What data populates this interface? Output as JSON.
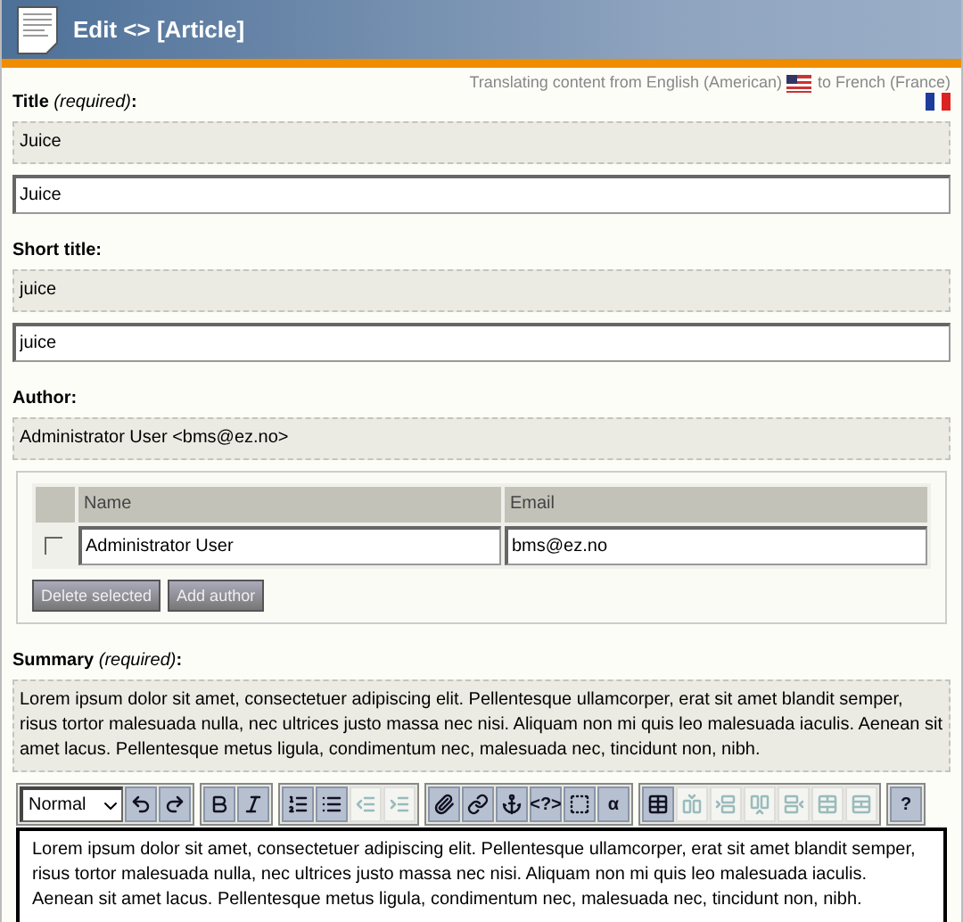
{
  "header": {
    "title": "Edit <> [Article]"
  },
  "translation": {
    "from": "Translating content from English (American)",
    "to": "to French (France)"
  },
  "fields": [
    {
      "label": "Title *(required)*:",
      "kind": "text",
      "original": "Juice",
      "value": "Juice"
    },
    {
      "label": "Short title:",
      "kind": "text",
      "original": "juice",
      "value": "juice"
    },
    {
      "label": "Author:",
      "kind": "authors",
      "original": "Administrator User <bms@ez.no>",
      "columns": [
        "Name",
        "Email"
      ],
      "rows": [
        {
          "name": "Administrator User",
          "email": "bms@ez.no",
          "checked": false
        }
      ],
      "buttons": [
        "Delete selected",
        "Add author"
      ]
    },
    {
      "label": "Summary *(required)*:",
      "kind": "richtext",
      "original": "Lorem ipsum dolor sit amet, consectetuer adipiscing elit. Pellentesque ullamcorper, erat sit amet blandit semper, risus tortor malesuada nulla, nec ultrices justo massa nec nisi. Aliquam non mi quis leo malesuada iaculis. Aenean sit amet lacus. Pellentesque metus ligula, condimentum nec, malesuada nec, tincidunt non, nibh.",
      "value": "Lorem ipsum dolor sit amet, consectetuer adipiscing elit. Pellentesque ullamcorper, erat sit amet blandit semper, risus tortor malesuada nulla, nec ultrices justo massa nec nisi. Aliquam non mi quis leo malesuada iaculis. Aenean sit amet lacus. Pellentesque metus ligula, condimentum nec, malesuada nec, tincidunt non, nibh.",
      "toolbar": [
        [
          {
            "kind": "select",
            "value": "Normal",
            "disabled": false
          },
          {
            "kind": "undo",
            "disabled": false
          },
          {
            "kind": "redo",
            "disabled": false
          }
        ],
        [
          {
            "kind": "bold",
            "disabled": false
          },
          {
            "kind": "italic",
            "disabled": false
          }
        ],
        [
          {
            "kind": "ordered-list",
            "disabled": false
          },
          {
            "kind": "bullet-list",
            "disabled": false
          },
          {
            "kind": "outdent",
            "disabled": true
          },
          {
            "kind": "indent",
            "disabled": true
          }
        ],
        [
          {
            "kind": "attachment",
            "disabled": false
          },
          {
            "kind": "link",
            "disabled": false
          },
          {
            "kind": "anchor",
            "disabled": false
          },
          {
            "kind": "text",
            "label": "<?>",
            "disabled": false
          },
          {
            "kind": "object",
            "disabled": false
          },
          {
            "kind": "text",
            "label": "α",
            "disabled": false
          }
        ],
        [
          {
            "kind": "table",
            "disabled": false
          },
          {
            "kind": "column-left",
            "disabled": true
          },
          {
            "kind": "row-split",
            "disabled": true
          },
          {
            "kind": "column-right",
            "disabled": true
          },
          {
            "kind": "row-below",
            "disabled": true
          },
          {
            "kind": "cell-merge",
            "disabled": true
          },
          {
            "kind": "cell-split",
            "disabled": true
          }
        ],
        [
          {
            "kind": "text",
            "label": "?",
            "disabled": false
          }
        ]
      ]
    }
  ]
}
